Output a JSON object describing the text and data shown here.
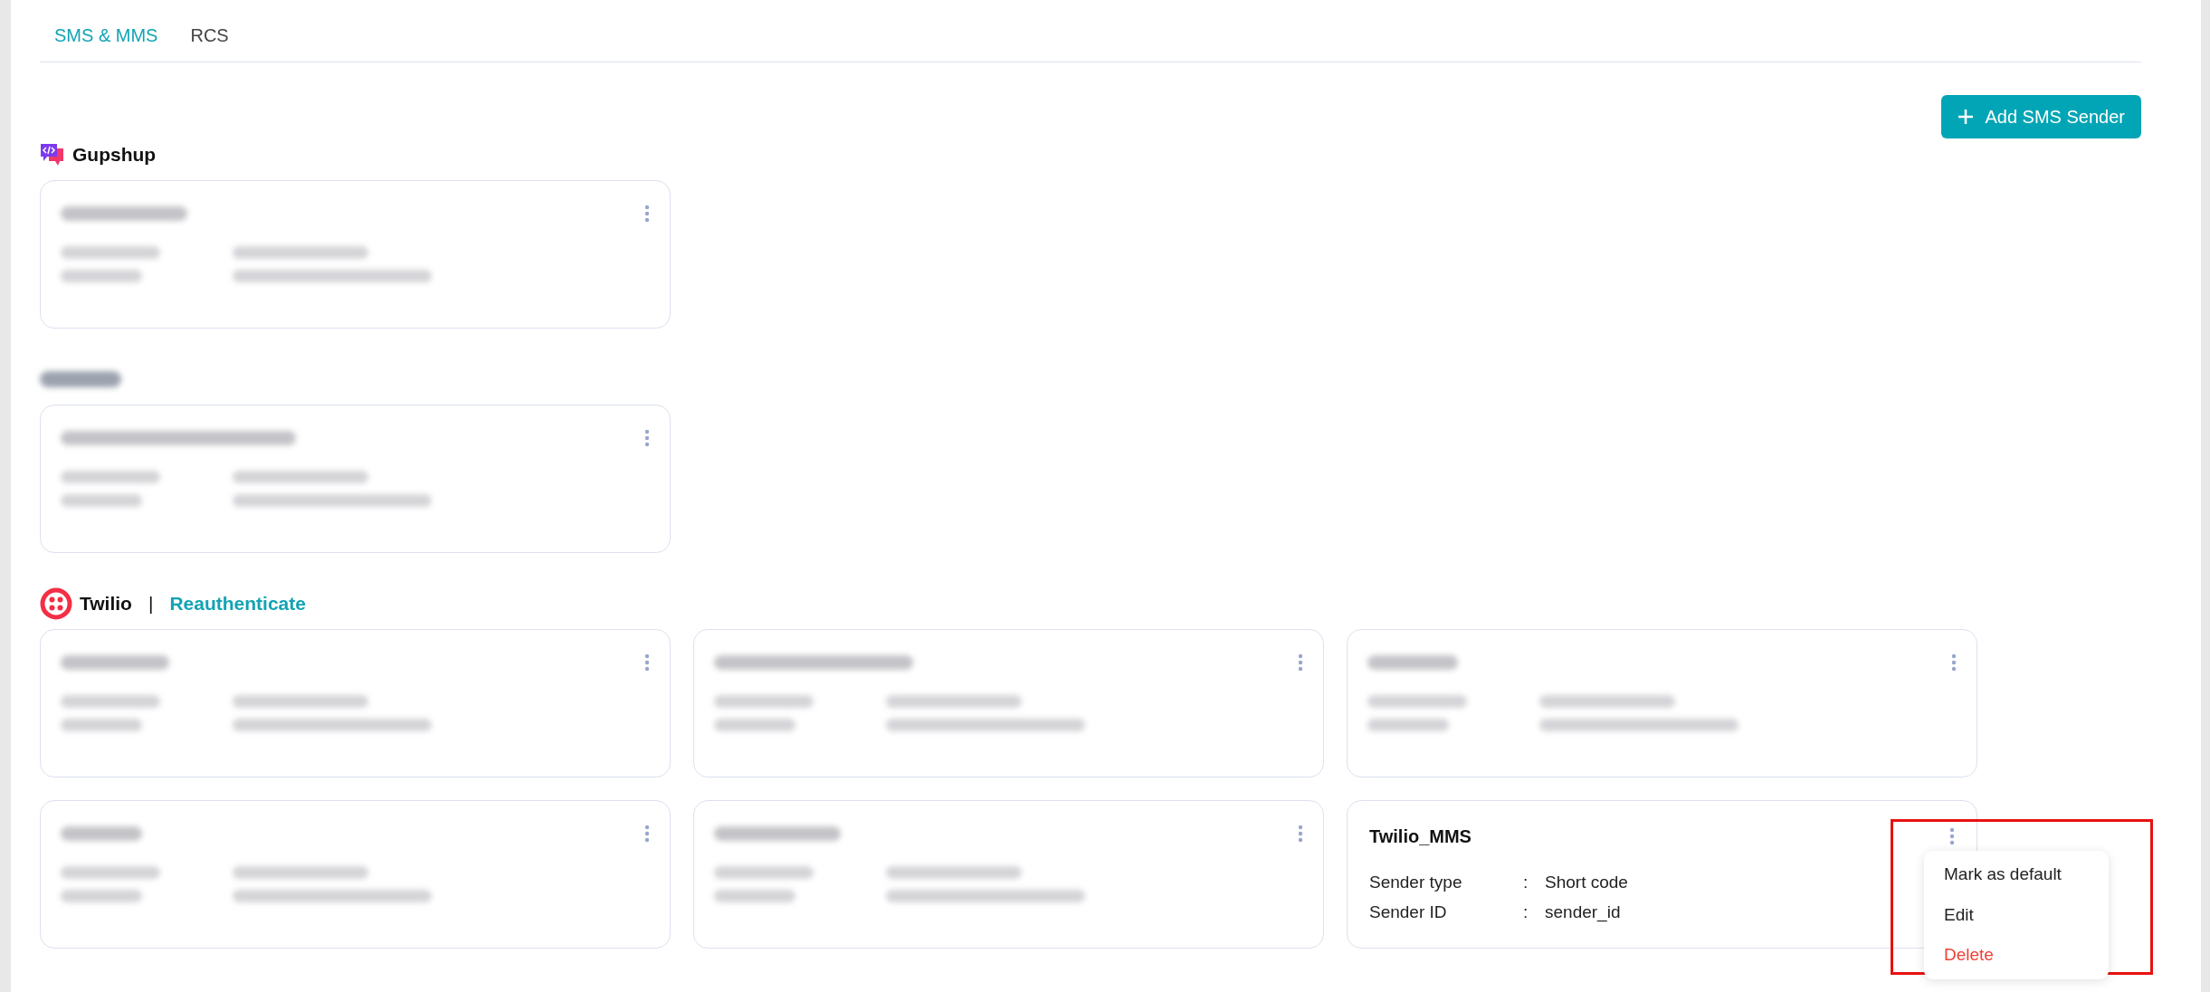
{
  "tabs": [
    {
      "label": "SMS & MMS",
      "selected": true
    },
    {
      "label": "RCS",
      "selected": false
    }
  ],
  "add_button": {
    "label": "Add SMS Sender"
  },
  "providers": [
    {
      "kind": "gupshup",
      "name": "Gupshup",
      "cards": [
        {
          "kind": "blurred"
        }
      ]
    },
    {
      "kind": "blurred",
      "cards": [
        {
          "kind": "blurred"
        }
      ]
    },
    {
      "kind": "twilio",
      "name": "Twilio",
      "separator": "|",
      "action": "Reauthenticate",
      "cards": [
        {
          "kind": "blurred"
        },
        {
          "kind": "blurred"
        },
        {
          "kind": "blurred"
        },
        {
          "kind": "blurred"
        },
        {
          "kind": "blurred"
        },
        {
          "kind": "visible",
          "title": "Twilio_MMS",
          "fields": [
            {
              "label": "Sender type",
              "sep": ":",
              "value": "Short code"
            },
            {
              "label": "Sender ID",
              "sep": ":",
              "value": "sender_id"
            }
          ],
          "menu": [
            {
              "label": "Mark as default",
              "kind": "normal"
            },
            {
              "label": "Edit",
              "kind": "normal"
            },
            {
              "label": "Delete",
              "kind": "danger"
            }
          ]
        }
      ]
    }
  ]
}
